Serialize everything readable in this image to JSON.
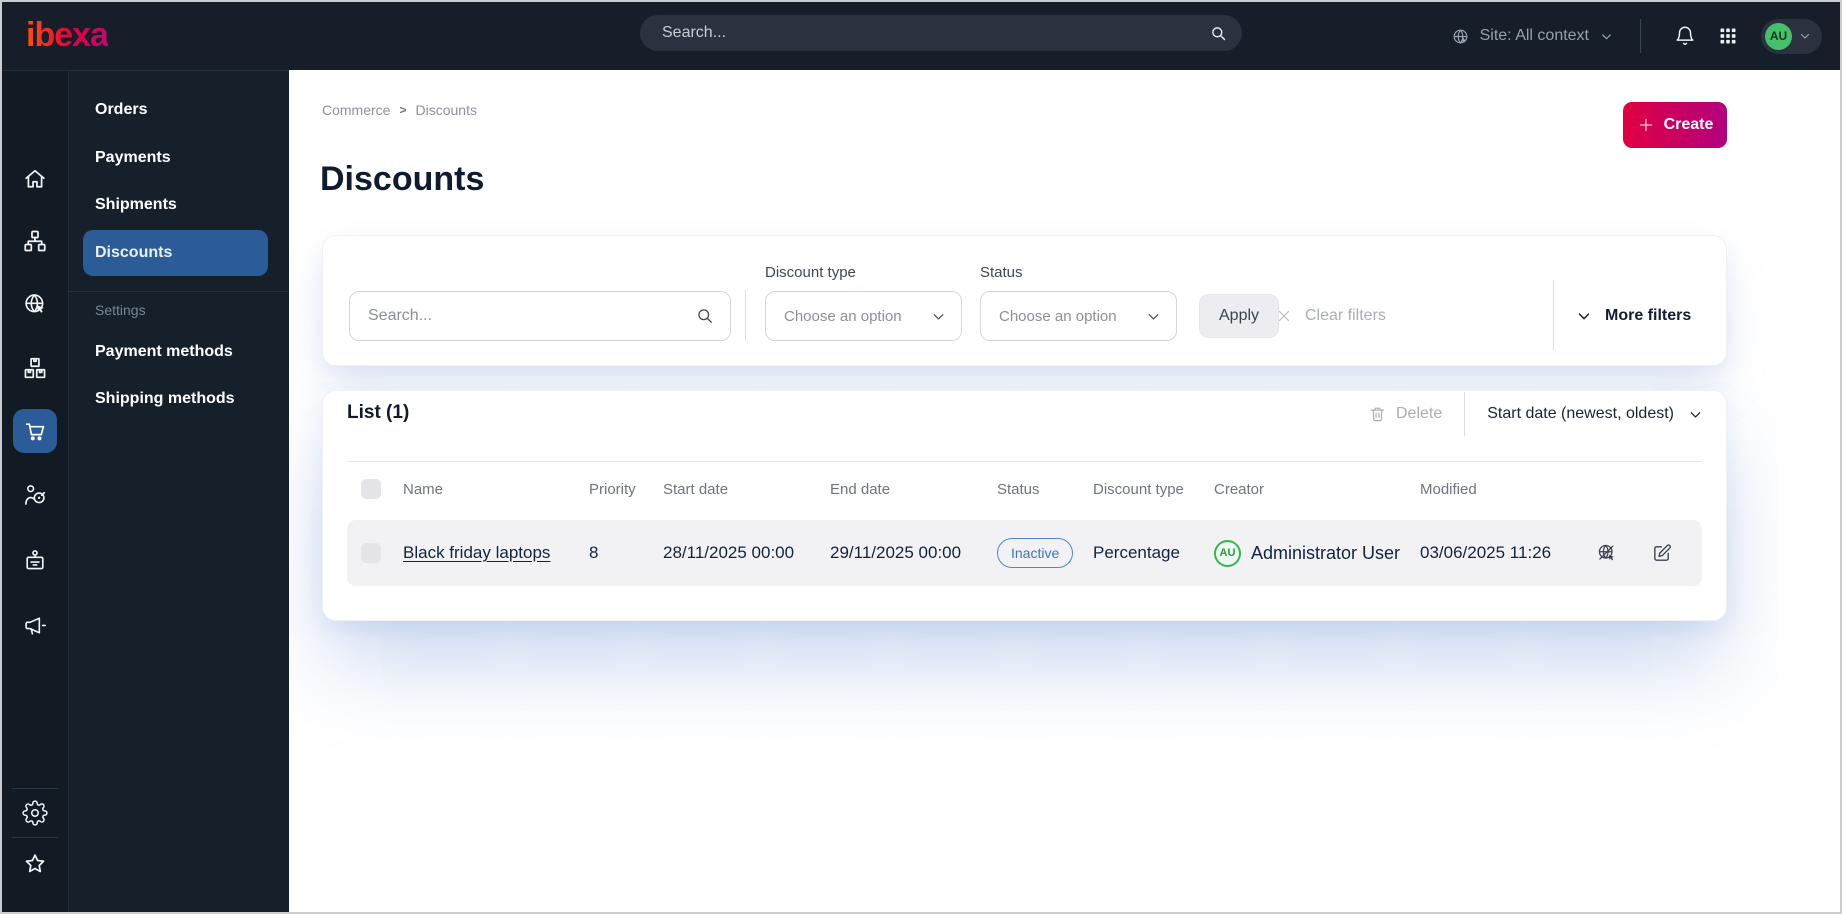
{
  "topbar": {
    "logo_text": "ibexa",
    "search_placeholder": "Search...",
    "site_context_label": "Site: All context",
    "user_initials": "AU"
  },
  "sidebar": {
    "icons": [
      "home",
      "content-tree",
      "site",
      "products",
      "commerce",
      "customers",
      "personnel",
      "marketing"
    ],
    "active_icon": "commerce",
    "bottom_icons": [
      "settings",
      "bookmarks"
    ]
  },
  "nav": {
    "items": [
      {
        "label": "Orders",
        "active": false
      },
      {
        "label": "Payments",
        "active": false
      },
      {
        "label": "Shipments",
        "active": false
      },
      {
        "label": "Discounts",
        "active": true
      }
    ],
    "section_label": "Settings",
    "section_items": [
      {
        "label": "Payment methods"
      },
      {
        "label": "Shipping methods"
      }
    ]
  },
  "page": {
    "breadcrumb": [
      "Commerce",
      "Discounts"
    ],
    "breadcrumb_separator": ">",
    "title": "Discounts",
    "create_button": "Create"
  },
  "filters": {
    "search_placeholder": "Search...",
    "discount_type_label": "Discount type",
    "status_label": "Status",
    "dropdown_placeholder": "Choose an option",
    "apply_label": "Apply",
    "clear_label": "Clear filters",
    "more_filters_label": "More filters"
  },
  "list": {
    "title": "List (1)",
    "delete_label": "Delete",
    "sort_label": "Start date (newest, oldest)",
    "columns": [
      "Name",
      "Priority",
      "Start date",
      "End date",
      "Status",
      "Discount type",
      "Creator",
      "Modified"
    ],
    "rows": [
      {
        "name": "Black friday laptops",
        "priority": "8",
        "start_date": "28/11/2025 00:00",
        "end_date": "29/11/2025 00:00",
        "status": "Inactive",
        "discount_type": "Percentage",
        "creator_initials": "AU",
        "creator": "Administrator User",
        "modified": "03/06/2025 11:26"
      }
    ]
  },
  "colors": {
    "topbar_bg": "#161f29",
    "active_nav_blue": "#2b5c97",
    "brand_gradient_start": "#ff4713",
    "brand_gradient_end": "#bf0a6d",
    "create_gradient_start": "#e00041",
    "create_gradient_end": "#b2017f",
    "status_badge_blue": "#4f86c6",
    "avatar_green": "#46c06a",
    "row_bg": "#f2f2f5"
  }
}
